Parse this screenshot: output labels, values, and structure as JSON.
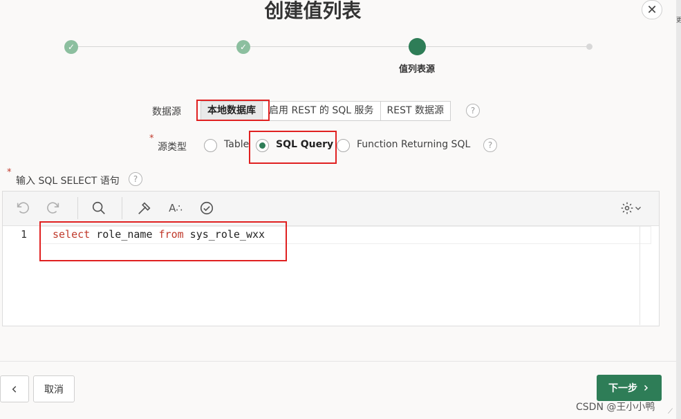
{
  "dialog": {
    "title": "创建值列表"
  },
  "wizard": {
    "current_label": "值列表源"
  },
  "datasource": {
    "label": "数据源",
    "options": [
      "本地数据库",
      "启用 REST 的 SQL 服务",
      "REST 数据源"
    ]
  },
  "source_type": {
    "label": "源类型",
    "options": [
      "Table",
      "SQL Query",
      "Function Returning SQL"
    ],
    "selected": "SQL Query"
  },
  "sql": {
    "label": "输入 SQL SELECT 语句",
    "line_number": "1",
    "tokens": [
      "select",
      " role_name ",
      "from",
      " sys_role_wxx"
    ]
  },
  "footer": {
    "cancel_label": "取消",
    "next_label": "下一步"
  },
  "watermark": "CSDN @王小小鸭",
  "side_fragment": "更",
  "icons": {
    "close": "close-icon",
    "check": "check-icon",
    "help": "help-icon",
    "undo": "undo-icon",
    "redo": "redo-icon",
    "search": "search-icon",
    "hammer": "hammer-icon",
    "format": "format-icon",
    "validate": "validate-icon",
    "settings": "gear-icon",
    "back": "chevron-left-icon",
    "next": "chevron-right-icon"
  },
  "colors": {
    "accent": "#2e7d57",
    "done_step": "#8cbf9f",
    "keyword": "#c0392b",
    "highlight_box": "#e02020"
  }
}
